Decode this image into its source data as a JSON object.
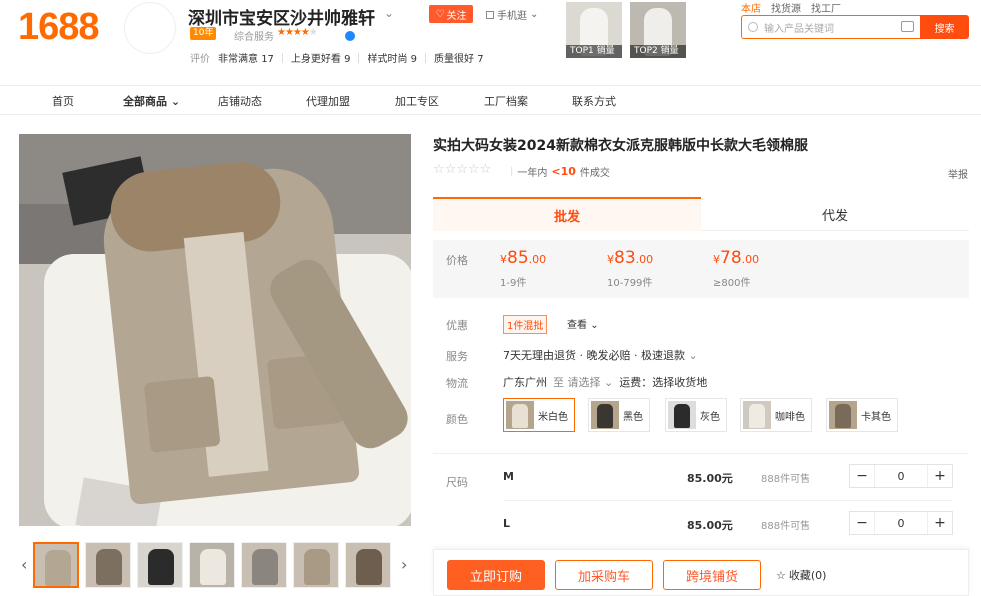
{
  "header": {
    "logo": "1688",
    "shop_name": "深圳市宝安区沙井帅雅轩",
    "follow_label": "关注",
    "mobile_label": "手机逛",
    "years_badge": "10年",
    "service_label": "综合服务",
    "ratings": [
      {
        "label": "评价",
        "value": ""
      },
      {
        "label": "非常满意",
        "value": "17"
      },
      {
        "label": "上身更好看",
        "value": "9"
      },
      {
        "label": "样式时尚",
        "value": "9"
      },
      {
        "label": "质量很好",
        "value": "7"
      }
    ],
    "top_products": [
      {
        "tag": "TOP1 销量"
      },
      {
        "tag": "TOP2 销量"
      }
    ],
    "search_tabs": [
      "本店",
      "找货源",
      "找工厂"
    ],
    "search_placeholder": "输入产品关键词",
    "search_button": "搜索"
  },
  "nav": {
    "items": [
      "首页",
      "全部商品",
      "店铺动态",
      "代理加盟",
      "加工专区",
      "工厂档案",
      "联系方式"
    ]
  },
  "product": {
    "title": "实拍大码女装2024新款棉衣女派克服韩版中长款大毛领棉服",
    "sales_prefix": "一年内",
    "sales_count": "<10",
    "sales_suffix": "件成交",
    "report": "举报",
    "tabs": [
      "批发",
      "代发"
    ],
    "price_label": "价格",
    "prices": [
      {
        "int": "85",
        "dec": ".00",
        "range": "1-9件"
      },
      {
        "int": "83",
        "dec": ".00",
        "range": "10-799件"
      },
      {
        "int": "78",
        "dec": ".00",
        "range": "≥800件"
      }
    ],
    "promo_label": "优惠",
    "promo_tag": "1件混批",
    "promo_view": "查看",
    "service_label": "服务",
    "service_text": "7天无理由退货 · 晚发必赔 · 极速退款",
    "logistics_label": "物流",
    "logistics_from": "广东广州",
    "logistics_to": "至 请选择",
    "logistics_fee": "运费：选择收货地",
    "color_label": "颜色",
    "colors": [
      {
        "name": "米白色",
        "color": "#e7e0d3"
      },
      {
        "name": "黑色",
        "color": "#3a3632"
      },
      {
        "name": "灰色",
        "color": "#2b2b2b"
      },
      {
        "name": "咖啡色",
        "color": "#efeae2"
      },
      {
        "name": "卡其色",
        "color": "#7a6a5a"
      }
    ],
    "size_label": "尺码",
    "sizes": [
      {
        "name": "M",
        "price": "85.00元",
        "stock": "888件可售",
        "qty": "0"
      },
      {
        "name": "L",
        "price": "85.00元",
        "stock": "888件可售",
        "qty": "0"
      }
    ]
  },
  "actions": {
    "buy_now": "立即订购",
    "add_cart": "加采购车",
    "cross_border": "跨境铺货",
    "favorite": "收藏(0)"
  },
  "colors": {
    "accent": "#ff6a00",
    "accent_strong": "#ff4c0f"
  }
}
